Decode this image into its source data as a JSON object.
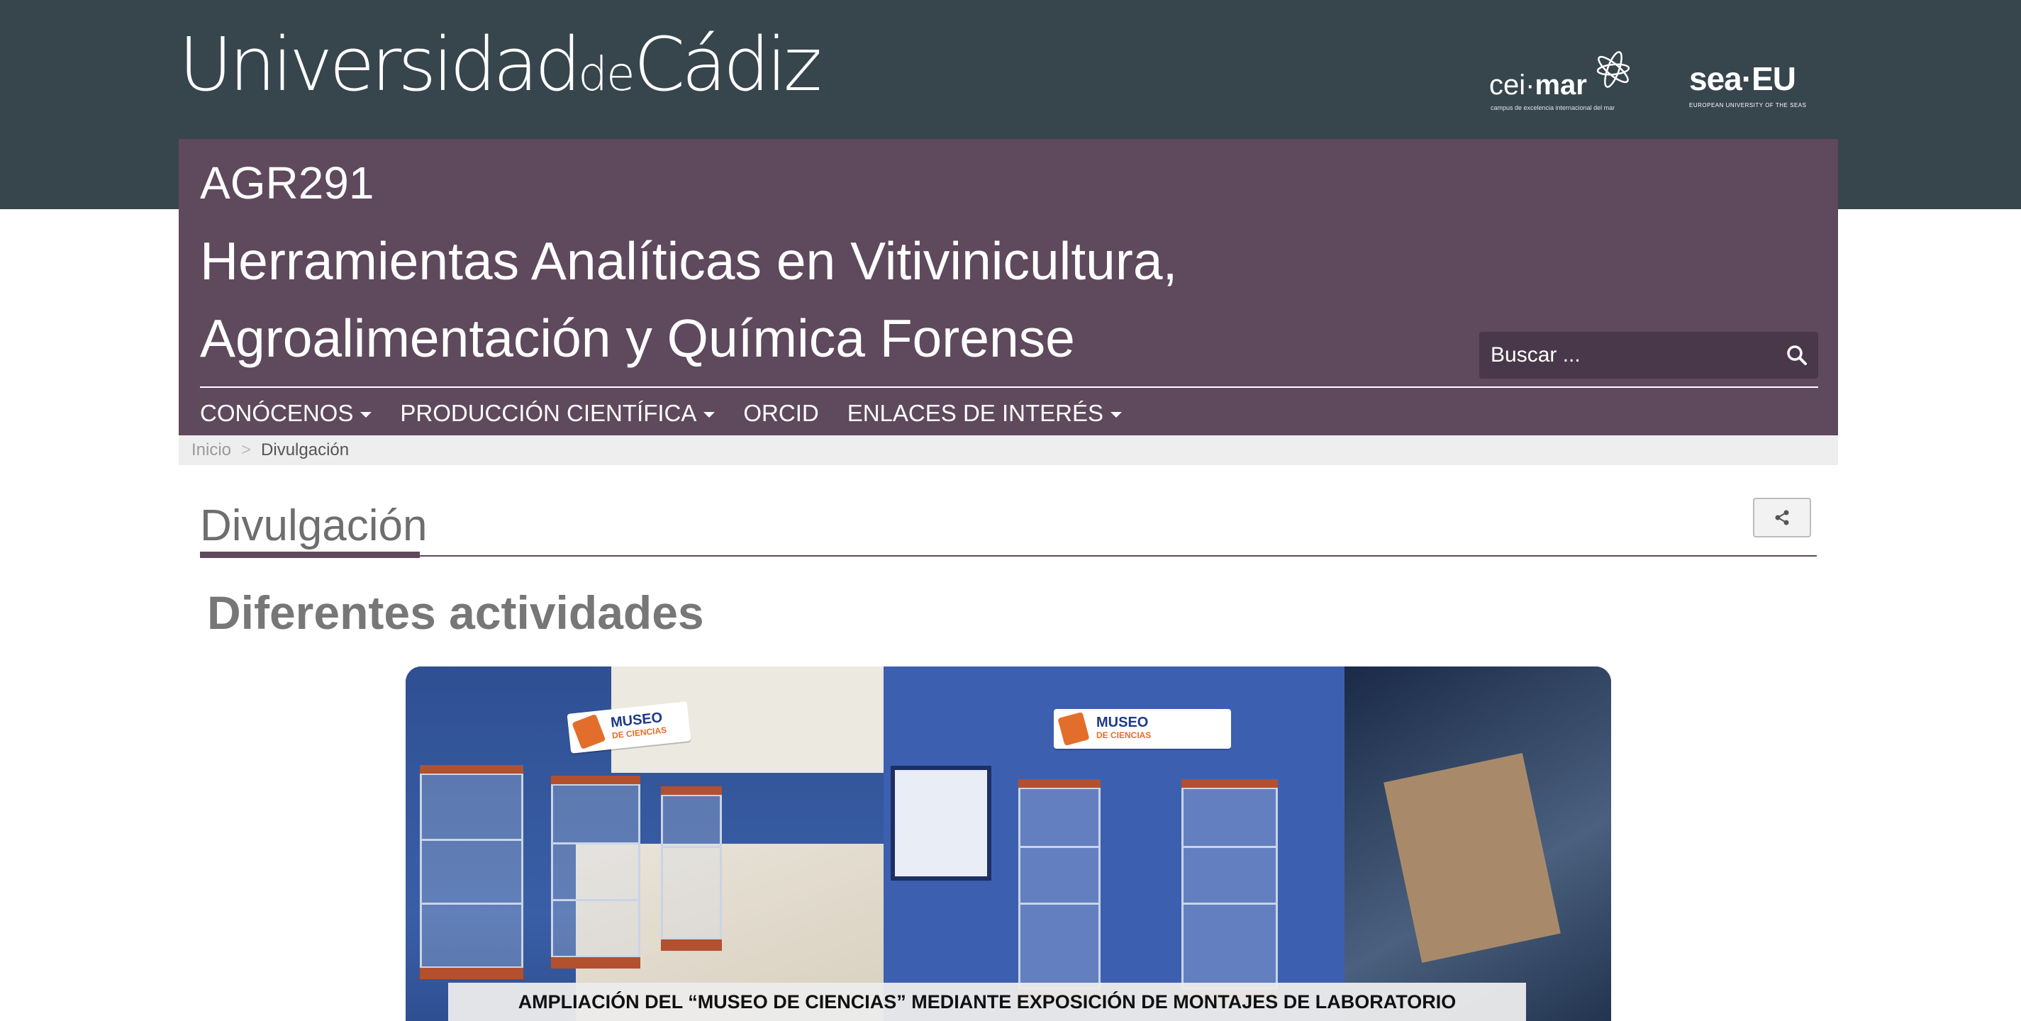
{
  "header": {
    "logo_part1": "Universidad",
    "logo_part2": "de",
    "logo_part3": "Cádiz",
    "partner1": {
      "word_light": "cei·",
      "word_bold": "mar",
      "tagline": "campus de excelencia internacional del mar"
    },
    "partner2": {
      "word": "sea·EU",
      "tagline": "EUROPEAN UNIVERSITY OF THE SEAS"
    }
  },
  "group": {
    "code": "AGR291",
    "title_line1": "Herramientas Analíticas en Vitivinicultura,",
    "title_line2": "Agroalimentación y Química Forense"
  },
  "search": {
    "placeholder": "Buscar ..."
  },
  "nav": {
    "items": [
      {
        "label": "CONÓCENOS",
        "dropdown": true
      },
      {
        "label": "PRODUCCIÓN CIENTÍFICA",
        "dropdown": true
      },
      {
        "label": "ORCID",
        "dropdown": false
      },
      {
        "label": "ENLACES DE INTERÉS",
        "dropdown": true
      }
    ]
  },
  "breadcrumb": {
    "home": "Inicio",
    "separator": ">",
    "current": "Divulgación"
  },
  "main": {
    "page_title": "Divulgación",
    "section_heading": "Diferentes actividades",
    "image": {
      "caption": "AMPLIACIÓN DEL “MUSEO DE CIENCIAS” MEDIANTE EXPOSICIÓN DE MONTAJES DE LABORATORIO",
      "sign_title": "MUSEO",
      "sign_subtitle": "DE CIENCIAS"
    }
  },
  "icons": {
    "search": "search-icon",
    "share": "share-icon",
    "caret": "caret-down-icon"
  },
  "colors": {
    "topbar": "#37454d",
    "brand_band": "#5f495c",
    "search_bg": "#48384a",
    "breadcrumb_bg": "#eeeeee",
    "heading_text": "#777777"
  }
}
